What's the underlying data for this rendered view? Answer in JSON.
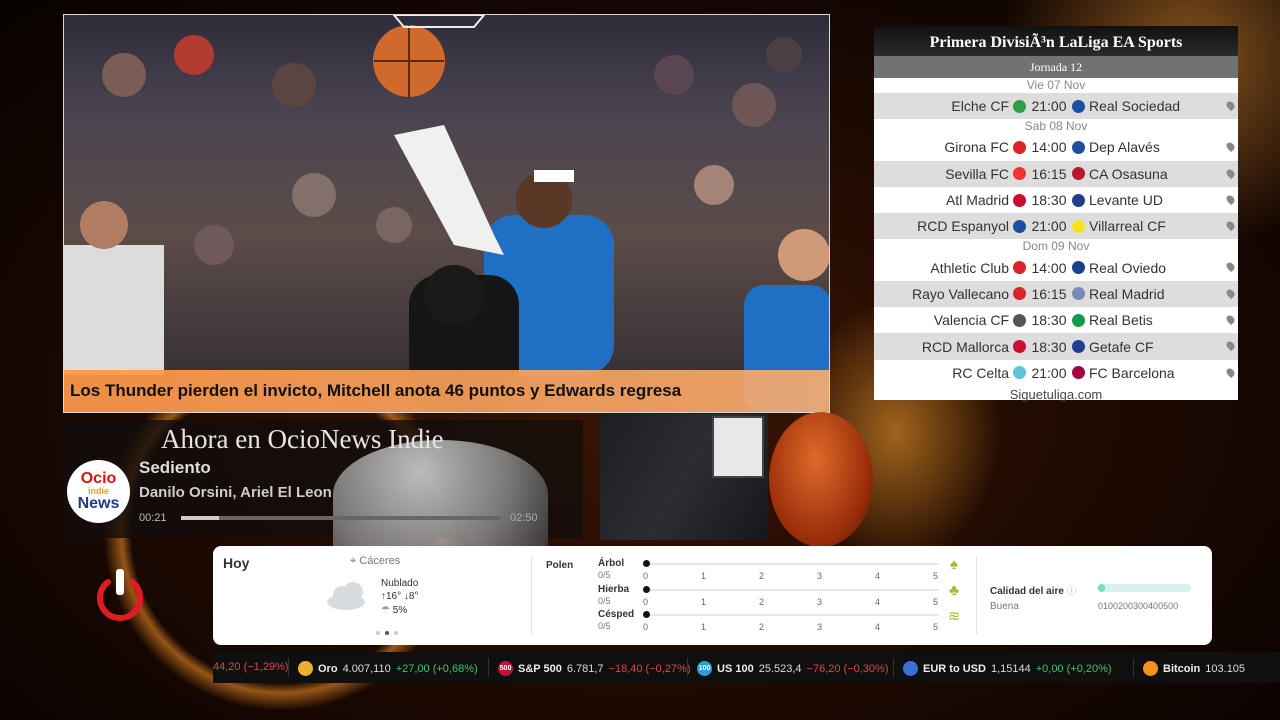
{
  "news": {
    "headline": "Los Thunder pierden el invicto, Mitchell anota 46 puntos y Edwards regresa"
  },
  "radio": {
    "title": "Ahora en OcioNews Indie",
    "logo_line1": "Ocio",
    "logo_line2": "indie",
    "logo_line3": "News",
    "song": "Sediento",
    "artist": "Danilo Orsini, Ariel El Leon",
    "time_current": "00:21",
    "time_total": "02:50",
    "progress": 0.12
  },
  "liga": {
    "title": "Primera DivisiÃ³n LaLiga EA Sports",
    "round": "Jornada 12",
    "footer": "Siguetuliga.com",
    "days": [
      {
        "date": "Vie 07 Nov",
        "matches": [
          {
            "home": "Elche CF",
            "time": "21:00",
            "away": "Real Sociedad",
            "home_color": "#2e9e46",
            "away_color": "#1d4fa0"
          }
        ]
      },
      {
        "date": "Sab 08 Nov",
        "matches": [
          {
            "home": "Girona FC",
            "time": "14:00",
            "away": "Dep Alavés",
            "home_color": "#d9252a",
            "away_color": "#1d4fa0"
          },
          {
            "home": "Sevilla FC",
            "time": "16:15",
            "away": "CA Osasuna",
            "home_color": "#e33",
            "away_color": "#b8172c"
          },
          {
            "home": "Atl Madrid",
            "time": "18:30",
            "away": "Levante UD",
            "home_color": "#c8102e",
            "away_color": "#223c8f"
          },
          {
            "home": "RCD Espanyol",
            "time": "21:00",
            "away": "Villarreal CF",
            "home_color": "#1d4fa0",
            "away_color": "#f5e31a"
          }
        ]
      },
      {
        "date": "Dom 09 Nov",
        "matches": [
          {
            "home": "Athletic Club",
            "time": "14:00",
            "away": "Real Oviedo",
            "home_color": "#d9252a",
            "away_color": "#1d3f8f"
          },
          {
            "home": "Rayo Vallecano",
            "time": "16:15",
            "away": "Real Madrid",
            "home_color": "#d9252a",
            "away_color": "#7a8ab8"
          },
          {
            "home": "Valencia CF",
            "time": "18:30",
            "away": "Real Betis",
            "home_color": "#555555",
            "away_color": "#0f9b4a"
          },
          {
            "home": "RCD Mallorca",
            "time": "18:30",
            "away": "Getafe CF",
            "home_color": "#c8102e",
            "away_color": "#1d3f8f"
          },
          {
            "home": "RC Celta",
            "time": "21:00",
            "away": "FC Barcelona",
            "home_color": "#5ec4d8",
            "away_color": "#a50044"
          }
        ]
      }
    ]
  },
  "weather": {
    "today_label": "Hoy",
    "location": "Cáceres",
    "condition": "Nublado",
    "temp_high": "16°",
    "temp_low": "8°",
    "rain": "5%",
    "pollen_label": "Polen",
    "pollen": [
      {
        "label": "Árbol",
        "score": "0/5",
        "value": 0,
        "icon": "tree-icon"
      },
      {
        "label": "Hierba",
        "score": "0/5",
        "value": 0,
        "icon": "grass-icon"
      },
      {
        "label": "Césped",
        "score": "0/5",
        "value": 0,
        "icon": "lawn-icon"
      }
    ],
    "pollen_scale": [
      "0",
      "1",
      "2",
      "3",
      "4",
      "5"
    ],
    "air_label": "Calidad del aire",
    "air_value_text": "Buena",
    "air_scale": "0100200300400500"
  },
  "ticker": [
    {
      "name": "",
      "value": "",
      "change": "44,20 (−1,29%)",
      "dir": "dn",
      "badge": "",
      "badge_color": ""
    },
    {
      "name": "Oro",
      "value": "4.007,110",
      "change": "+27,00 (+0,68%)",
      "dir": "up",
      "badge": "",
      "badge_color": "#e7b12c"
    },
    {
      "name": "S&P 500",
      "value": "6.781,7",
      "change": "−18,40 (−0,27%)",
      "dir": "dn",
      "badge": "500",
      "badge_color": "#c0133a"
    },
    {
      "name": "US 100",
      "value": "25.523,4",
      "change": "−76,20 (−0,30%)",
      "dir": "dn",
      "badge": "100",
      "badge_color": "#2a9fd6"
    },
    {
      "name": "EUR to USD",
      "value": "1,15144",
      "change": "+0,00 (+0,20%)",
      "dir": "up",
      "badge": "",
      "badge_color": "#3b6fd6"
    },
    {
      "name": "Bitcoin",
      "value": "103.105",
      "change": "",
      "dir": "",
      "badge": "",
      "badge_color": "#f7931a"
    }
  ],
  "colors": {
    "headline_bg": "#ff9a4a",
    "up": "#3ec46d",
    "down": "#e04545",
    "power": "#e11b22"
  }
}
